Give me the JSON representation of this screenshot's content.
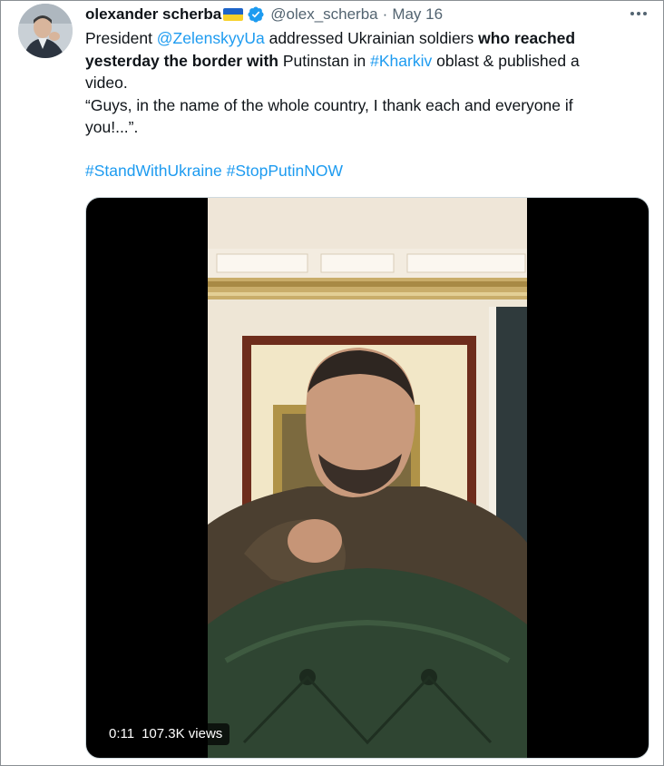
{
  "tweet": {
    "author_name": "olexander scherba",
    "handle": "@olex_scherba",
    "separator": "·",
    "date": "May 16",
    "text": {
      "l1_a": "President ",
      "l1_mention": "@ZelenskyyUa",
      "l1_b": " addressed Ukrainian soldiers ",
      "l1_bold": "who reached",
      "l2_bold": "yesterday the border with",
      "l2_a": " Putinstan in ",
      "l2_hashtag": "#Kharkiv",
      "l2_b": " oblast & published a",
      "l3": "video.",
      "l4": "“Guys, in the name of the whole country, I thank each and everyone if",
      "l5": "you!...”."
    },
    "hashtags": "#StandWithUkraine #StopPutinNOW",
    "video": {
      "duration": "0:11",
      "views": "107.3K views"
    }
  },
  "icons": {
    "verified": "verified-badge-icon",
    "more": "more-options-icon",
    "flag": "ukraine-flag-emoji"
  },
  "colors": {
    "link": "#1d9bf0",
    "secondary_text": "#536471",
    "flag_blue": "#1d64c8",
    "flag_yellow": "#f7d12b"
  }
}
